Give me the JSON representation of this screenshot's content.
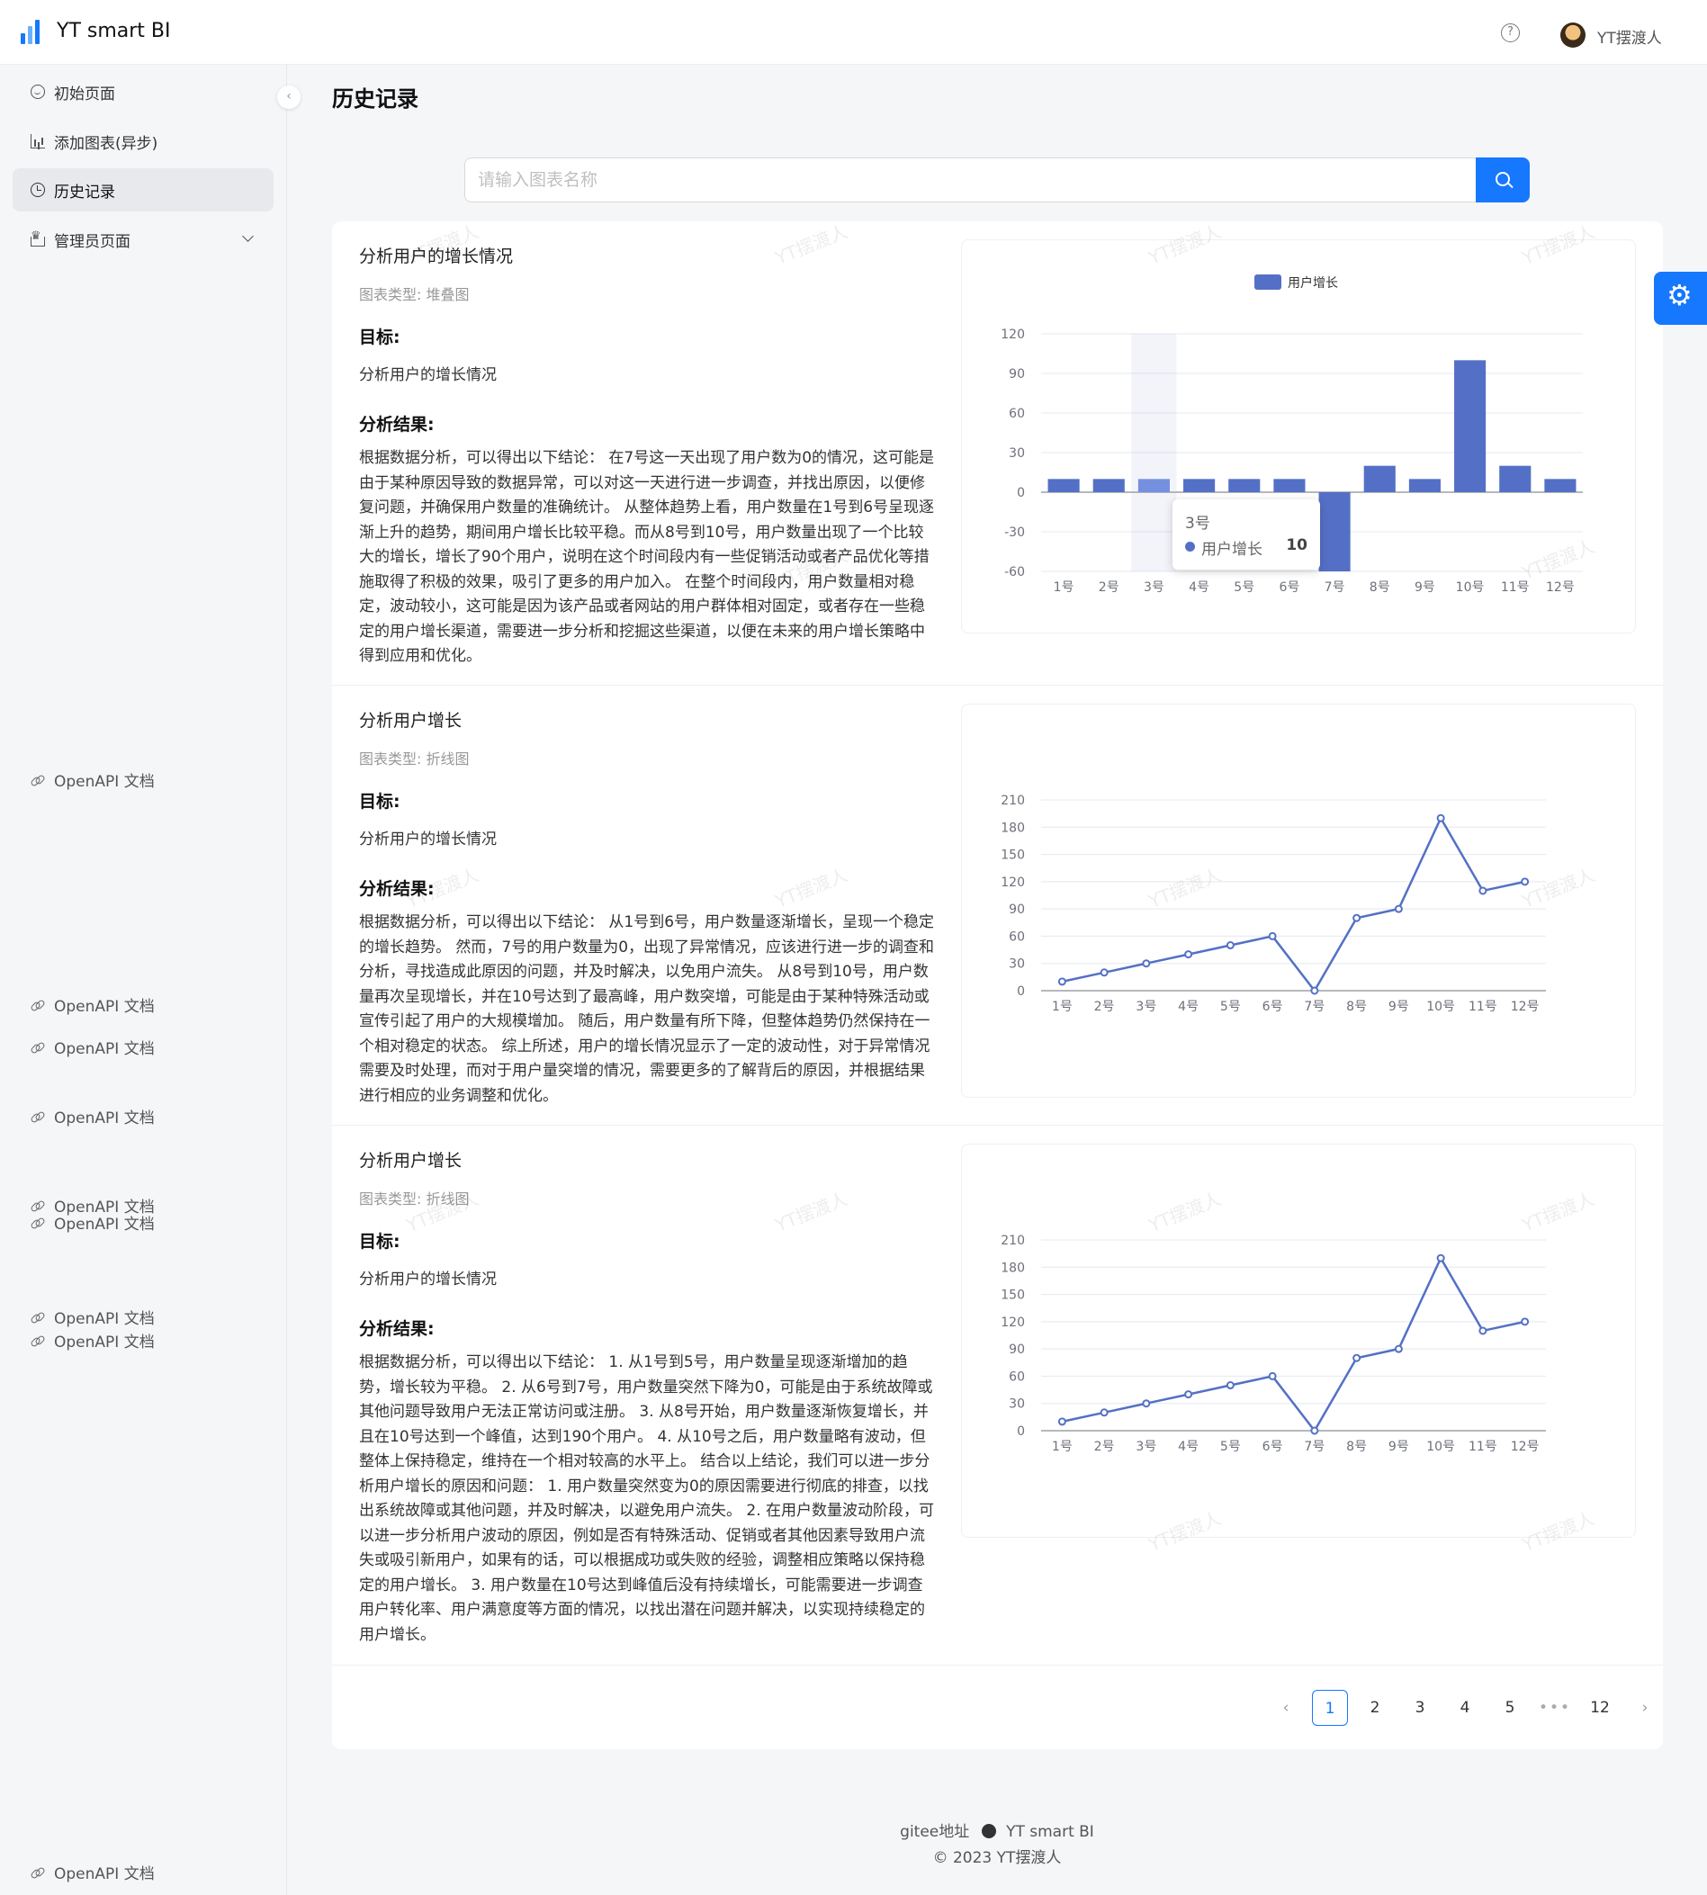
{
  "header": {
    "app_title": "YT smart BI",
    "user_name": "YT摆渡人",
    "help_icon": "?"
  },
  "sidebar": {
    "items": [
      {
        "label": "初始页面",
        "icon": "smile-icon"
      },
      {
        "label": "添加图表(异步)",
        "icon": "bar-chart-icon"
      },
      {
        "label": "历史记录",
        "icon": "history-icon",
        "active": true
      },
      {
        "label": "管理员页面",
        "icon": "crown-icon",
        "expandable": true
      }
    ],
    "links": [
      "OpenAPI 文档",
      "OpenAPI 文档",
      "OpenAPI 文档",
      "OpenAPI 文档",
      "OpenAPI 文档",
      "OpenAPI 文档",
      "OpenAPI 文档",
      "OpenAPI 文档",
      "OpenAPI 文档"
    ],
    "collapse_icon": "‹"
  },
  "main": {
    "title": "历史记录",
    "search": {
      "placeholder": "请输入图表名称",
      "value": ""
    },
    "goal_heading": "目标:",
    "result_heading": "分析结果:",
    "watermark": "YT摆渡人",
    "charts": [
      {
        "name": "分析用户的增长情况",
        "type_label": "图表类型: 堆叠图",
        "goal": "分析用户的增长情况",
        "result": "根据数据分析，可以得出以下结论： 在7号这一天出现了用户数为0的情况，这可能是由于某种原因导致的数据异常，可以对这一天进行进一步调查，并找出原因，以便修复问题，并确保用户数量的准确统计。 从整体趋势上看，用户数量在1号到6号呈现逐渐上升的趋势，期间用户增长比较平稳。而从8号到10号，用户数量出现了一个比较大的增长，增长了90个用户，说明在这个时间段内有一些促销活动或者产品优化等措施取得了积极的效果，吸引了更多的用户加入。 在整个时间段内，用户数量相对稳定，波动较小，这可能是因为该产品或者网站的用户群体相对固定，或者存在一些稳定的用户增长渠道，需要进一步分析和挖掘这些渠道，以便在未来的用户增长策略中得到应用和优化。",
        "tooltip": {
          "category": "3号",
          "series": "用户增长",
          "value": "10"
        }
      },
      {
        "name": "分析用户增长",
        "type_label": "图表类型: 折线图",
        "goal": "分析用户的增长情况",
        "result": "根据数据分析，可以得出以下结论： 从1号到6号，用户数量逐渐增长，呈现一个稳定的增长趋势。 然而，7号的用户数量为0，出现了异常情况，应该进行进一步的调查和分析，寻找造成此原因的问题，并及时解决，以免用户流失。 从8号到10号，用户数量再次呈现增长，并在10号达到了最高峰，用户数突增，可能是由于某种特殊活动或宣传引起了用户的大规模增加。 随后，用户数量有所下降，但整体趋势仍然保持在一个相对稳定的状态。 综上所述，用户的增长情况显示了一定的波动性，对于异常情况需要及时处理，而对于用户量突增的情况，需要更多的了解背后的原因，并根据结果进行相应的业务调整和优化。"
      },
      {
        "name": "分析用户增长",
        "type_label": "图表类型: 折线图",
        "goal": "分析用户的增长情况",
        "result": "根据数据分析，可以得出以下结论： 1. 从1号到5号，用户数量呈现逐渐增加的趋势，增长较为平稳。 2. 从6号到7号，用户数量突然下降为0，可能是由于系统故障或其他问题导致用户无法正常访问或注册。 3. 从8号开始，用户数量逐渐恢复增长，并且在10号达到一个峰值，达到190个用户。 4. 从10号之后，用户数量略有波动，但整体上保持稳定，维持在一个相对较高的水平上。 结合以上结论，我们可以进一步分析用户增长的原因和问题： 1. 用户数量突然变为0的原因需要进行彻底的排查，以找出系统故障或其他问题，并及时解决，以避免用户流失。 2. 在用户数量波动阶段，可以进一步分析用户波动的原因，例如是否有特殊活动、促销或者其他因素导致用户流失或吸引新用户，如果有的话，可以根据成功或失败的经验，调整相应策略以保持稳定的用户增长。 3. 用户数量在10号达到峰值后没有持续增长，可能需要进一步调查用户转化率、用户满意度等方面的情况，以找出潜在问题并解决，以实现持续稳定的用户增长。"
      }
    ],
    "pagination": {
      "prev": "‹",
      "next": "›",
      "pages": [
        "1",
        "2",
        "3",
        "4",
        "5"
      ],
      "ellipsis": "•••",
      "last": "12",
      "current": "1"
    }
  },
  "chart_data": [
    {
      "type": "bar",
      "legend": "用户增长",
      "categories": [
        "1号",
        "2号",
        "3号",
        "4号",
        "5号",
        "6号",
        "7号",
        "8号",
        "9号",
        "10号",
        "11号",
        "12号"
      ],
      "series": [
        {
          "name": "用户增长",
          "values": [
            10,
            10,
            10,
            10,
            10,
            10,
            -60,
            20,
            10,
            100,
            20,
            10
          ]
        }
      ],
      "yticks": [
        "120",
        "90",
        "60",
        "30",
        "0",
        "-30",
        "-60"
      ],
      "ylim": [
        -60,
        120
      ],
      "highlight_index": 2,
      "color": "#5470c6"
    },
    {
      "type": "line",
      "categories": [
        "1号",
        "2号",
        "3号",
        "4号",
        "5号",
        "6号",
        "7号",
        "8号",
        "9号",
        "10号",
        "11号",
        "12号"
      ],
      "series": [
        {
          "values": [
            10,
            20,
            30,
            40,
            50,
            60,
            0,
            80,
            90,
            190,
            110,
            120
          ]
        }
      ],
      "yticks": [
        "210",
        "180",
        "150",
        "120",
        "90",
        "60",
        "30",
        "0"
      ],
      "ylim": [
        0,
        210
      ],
      "color": "#5470c6"
    },
    {
      "type": "line",
      "categories": [
        "1号",
        "2号",
        "3号",
        "4号",
        "5号",
        "6号",
        "7号",
        "8号",
        "9号",
        "10号",
        "11号",
        "12号"
      ],
      "series": [
        {
          "values": [
            10,
            20,
            30,
            40,
            50,
            60,
            0,
            80,
            90,
            190,
            110,
            120
          ]
        }
      ],
      "yticks": [
        "210",
        "180",
        "150",
        "120",
        "90",
        "60",
        "30",
        "0"
      ],
      "ylim": [
        0,
        210
      ],
      "color": "#5470c6"
    }
  ],
  "footer": {
    "gitee": "gitee地址",
    "project": "YT smart BI",
    "copyright": "© 2023 YT摆渡人"
  }
}
